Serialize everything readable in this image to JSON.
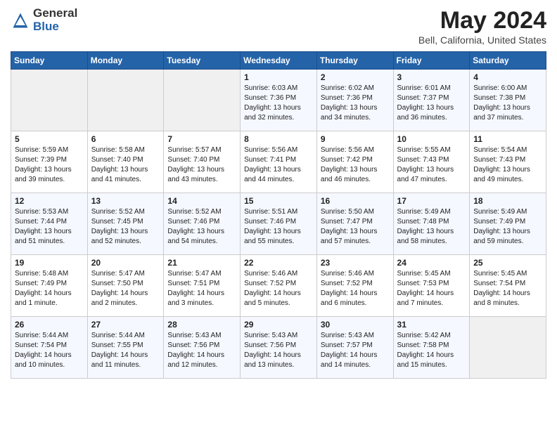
{
  "logo": {
    "general": "General",
    "blue": "Blue"
  },
  "title": "May 2024",
  "subtitle": "Bell, California, United States",
  "headers": [
    "Sunday",
    "Monday",
    "Tuesday",
    "Wednesday",
    "Thursday",
    "Friday",
    "Saturday"
  ],
  "weeks": [
    [
      {
        "day": "",
        "info": ""
      },
      {
        "day": "",
        "info": ""
      },
      {
        "day": "",
        "info": ""
      },
      {
        "day": "1",
        "info": "Sunrise: 6:03 AM\nSunset: 7:36 PM\nDaylight: 13 hours\nand 32 minutes."
      },
      {
        "day": "2",
        "info": "Sunrise: 6:02 AM\nSunset: 7:36 PM\nDaylight: 13 hours\nand 34 minutes."
      },
      {
        "day": "3",
        "info": "Sunrise: 6:01 AM\nSunset: 7:37 PM\nDaylight: 13 hours\nand 36 minutes."
      },
      {
        "day": "4",
        "info": "Sunrise: 6:00 AM\nSunset: 7:38 PM\nDaylight: 13 hours\nand 37 minutes."
      }
    ],
    [
      {
        "day": "5",
        "info": "Sunrise: 5:59 AM\nSunset: 7:39 PM\nDaylight: 13 hours\nand 39 minutes."
      },
      {
        "day": "6",
        "info": "Sunrise: 5:58 AM\nSunset: 7:40 PM\nDaylight: 13 hours\nand 41 minutes."
      },
      {
        "day": "7",
        "info": "Sunrise: 5:57 AM\nSunset: 7:40 PM\nDaylight: 13 hours\nand 43 minutes."
      },
      {
        "day": "8",
        "info": "Sunrise: 5:56 AM\nSunset: 7:41 PM\nDaylight: 13 hours\nand 44 minutes."
      },
      {
        "day": "9",
        "info": "Sunrise: 5:56 AM\nSunset: 7:42 PM\nDaylight: 13 hours\nand 46 minutes."
      },
      {
        "day": "10",
        "info": "Sunrise: 5:55 AM\nSunset: 7:43 PM\nDaylight: 13 hours\nand 47 minutes."
      },
      {
        "day": "11",
        "info": "Sunrise: 5:54 AM\nSunset: 7:43 PM\nDaylight: 13 hours\nand 49 minutes."
      }
    ],
    [
      {
        "day": "12",
        "info": "Sunrise: 5:53 AM\nSunset: 7:44 PM\nDaylight: 13 hours\nand 51 minutes."
      },
      {
        "day": "13",
        "info": "Sunrise: 5:52 AM\nSunset: 7:45 PM\nDaylight: 13 hours\nand 52 minutes."
      },
      {
        "day": "14",
        "info": "Sunrise: 5:52 AM\nSunset: 7:46 PM\nDaylight: 13 hours\nand 54 minutes."
      },
      {
        "day": "15",
        "info": "Sunrise: 5:51 AM\nSunset: 7:46 PM\nDaylight: 13 hours\nand 55 minutes."
      },
      {
        "day": "16",
        "info": "Sunrise: 5:50 AM\nSunset: 7:47 PM\nDaylight: 13 hours\nand 57 minutes."
      },
      {
        "day": "17",
        "info": "Sunrise: 5:49 AM\nSunset: 7:48 PM\nDaylight: 13 hours\nand 58 minutes."
      },
      {
        "day": "18",
        "info": "Sunrise: 5:49 AM\nSunset: 7:49 PM\nDaylight: 13 hours\nand 59 minutes."
      }
    ],
    [
      {
        "day": "19",
        "info": "Sunrise: 5:48 AM\nSunset: 7:49 PM\nDaylight: 14 hours\nand 1 minute."
      },
      {
        "day": "20",
        "info": "Sunrise: 5:47 AM\nSunset: 7:50 PM\nDaylight: 14 hours\nand 2 minutes."
      },
      {
        "day": "21",
        "info": "Sunrise: 5:47 AM\nSunset: 7:51 PM\nDaylight: 14 hours\nand 3 minutes."
      },
      {
        "day": "22",
        "info": "Sunrise: 5:46 AM\nSunset: 7:52 PM\nDaylight: 14 hours\nand 5 minutes."
      },
      {
        "day": "23",
        "info": "Sunrise: 5:46 AM\nSunset: 7:52 PM\nDaylight: 14 hours\nand 6 minutes."
      },
      {
        "day": "24",
        "info": "Sunrise: 5:45 AM\nSunset: 7:53 PM\nDaylight: 14 hours\nand 7 minutes."
      },
      {
        "day": "25",
        "info": "Sunrise: 5:45 AM\nSunset: 7:54 PM\nDaylight: 14 hours\nand 8 minutes."
      }
    ],
    [
      {
        "day": "26",
        "info": "Sunrise: 5:44 AM\nSunset: 7:54 PM\nDaylight: 14 hours\nand 10 minutes."
      },
      {
        "day": "27",
        "info": "Sunrise: 5:44 AM\nSunset: 7:55 PM\nDaylight: 14 hours\nand 11 minutes."
      },
      {
        "day": "28",
        "info": "Sunrise: 5:43 AM\nSunset: 7:56 PM\nDaylight: 14 hours\nand 12 minutes."
      },
      {
        "day": "29",
        "info": "Sunrise: 5:43 AM\nSunset: 7:56 PM\nDaylight: 14 hours\nand 13 minutes."
      },
      {
        "day": "30",
        "info": "Sunrise: 5:43 AM\nSunset: 7:57 PM\nDaylight: 14 hours\nand 14 minutes."
      },
      {
        "day": "31",
        "info": "Sunrise: 5:42 AM\nSunset: 7:58 PM\nDaylight: 14 hours\nand 15 minutes."
      },
      {
        "day": "",
        "info": ""
      }
    ]
  ]
}
